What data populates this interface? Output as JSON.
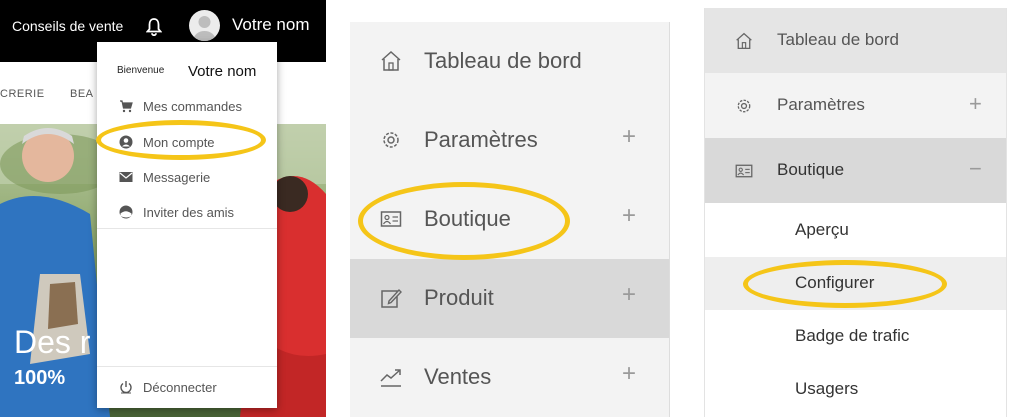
{
  "panel1": {
    "brand": "Conseils de vente",
    "username": "Votre nom",
    "nav_text": "CRERIE",
    "nav_text2": "BEA",
    "hero_headline": "Des r",
    "hero_subtext": "100%",
    "user_menu": {
      "welcome": "Bienvenue",
      "name": "Votre nom",
      "items": [
        {
          "label": "Mes commandes",
          "icon": "cart-icon"
        },
        {
          "label": "Mon compte",
          "icon": "account-icon"
        },
        {
          "label": "Messagerie",
          "icon": "mail-icon"
        },
        {
          "label": "Inviter des amis",
          "icon": "invite-icon"
        }
      ],
      "logout": "Déconnecter"
    }
  },
  "panel2": {
    "items": [
      {
        "label": "Tableau de bord",
        "icon": "home-icon",
        "expand": ""
      },
      {
        "label": "Paramètres",
        "icon": "gear-icon",
        "expand": "+"
      },
      {
        "label": "Boutique",
        "icon": "store-icon",
        "expand": "+"
      },
      {
        "label": "Produit",
        "icon": "edit-icon",
        "expand": "+"
      },
      {
        "label": "Ventes",
        "icon": "trend-icon",
        "expand": "+"
      }
    ]
  },
  "panel3": {
    "items": [
      {
        "label": "Tableau de bord",
        "icon": "home-icon",
        "expand": ""
      },
      {
        "label": "Paramètres",
        "icon": "gear-icon",
        "expand": "+"
      },
      {
        "label": "Boutique",
        "icon": "store-icon",
        "expand": "−"
      }
    ],
    "subitems": [
      {
        "label": "Aperçu"
      },
      {
        "label": "Configurer"
      },
      {
        "label": "Badge de trafic"
      },
      {
        "label": "Usagers"
      }
    ]
  },
  "colors": {
    "highlight": "#f5c518",
    "topbar": "#000000",
    "active_row": "#dddddd",
    "panel_bg": "#f3f3f3"
  }
}
